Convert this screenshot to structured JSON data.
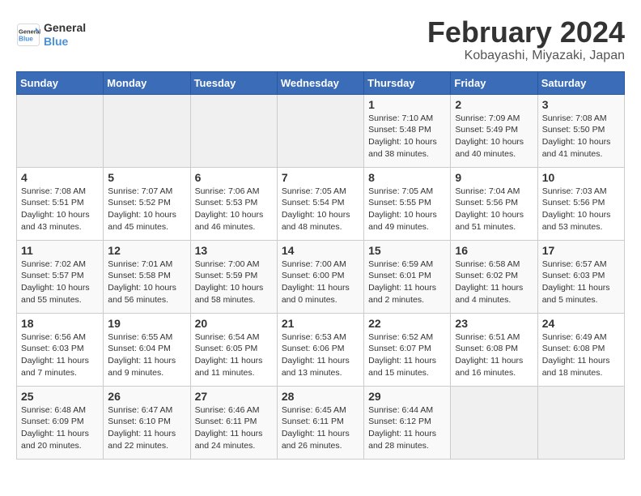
{
  "logo": {
    "line1": "General",
    "line2": "Blue"
  },
  "title": "February 2024",
  "subtitle": "Kobayashi, Miyazaki, Japan",
  "headers": [
    "Sunday",
    "Monday",
    "Tuesday",
    "Wednesday",
    "Thursday",
    "Friday",
    "Saturday"
  ],
  "weeks": [
    [
      {
        "day": "",
        "info": ""
      },
      {
        "day": "",
        "info": ""
      },
      {
        "day": "",
        "info": ""
      },
      {
        "day": "",
        "info": ""
      },
      {
        "day": "1",
        "info": "Sunrise: 7:10 AM\nSunset: 5:48 PM\nDaylight: 10 hours\nand 38 minutes."
      },
      {
        "day": "2",
        "info": "Sunrise: 7:09 AM\nSunset: 5:49 PM\nDaylight: 10 hours\nand 40 minutes."
      },
      {
        "day": "3",
        "info": "Sunrise: 7:08 AM\nSunset: 5:50 PM\nDaylight: 10 hours\nand 41 minutes."
      }
    ],
    [
      {
        "day": "4",
        "info": "Sunrise: 7:08 AM\nSunset: 5:51 PM\nDaylight: 10 hours\nand 43 minutes."
      },
      {
        "day": "5",
        "info": "Sunrise: 7:07 AM\nSunset: 5:52 PM\nDaylight: 10 hours\nand 45 minutes."
      },
      {
        "day": "6",
        "info": "Sunrise: 7:06 AM\nSunset: 5:53 PM\nDaylight: 10 hours\nand 46 minutes."
      },
      {
        "day": "7",
        "info": "Sunrise: 7:05 AM\nSunset: 5:54 PM\nDaylight: 10 hours\nand 48 minutes."
      },
      {
        "day": "8",
        "info": "Sunrise: 7:05 AM\nSunset: 5:55 PM\nDaylight: 10 hours\nand 49 minutes."
      },
      {
        "day": "9",
        "info": "Sunrise: 7:04 AM\nSunset: 5:56 PM\nDaylight: 10 hours\nand 51 minutes."
      },
      {
        "day": "10",
        "info": "Sunrise: 7:03 AM\nSunset: 5:56 PM\nDaylight: 10 hours\nand 53 minutes."
      }
    ],
    [
      {
        "day": "11",
        "info": "Sunrise: 7:02 AM\nSunset: 5:57 PM\nDaylight: 10 hours\nand 55 minutes."
      },
      {
        "day": "12",
        "info": "Sunrise: 7:01 AM\nSunset: 5:58 PM\nDaylight: 10 hours\nand 56 minutes."
      },
      {
        "day": "13",
        "info": "Sunrise: 7:00 AM\nSunset: 5:59 PM\nDaylight: 10 hours\nand 58 minutes."
      },
      {
        "day": "14",
        "info": "Sunrise: 7:00 AM\nSunset: 6:00 PM\nDaylight: 11 hours\nand 0 minutes."
      },
      {
        "day": "15",
        "info": "Sunrise: 6:59 AM\nSunset: 6:01 PM\nDaylight: 11 hours\nand 2 minutes."
      },
      {
        "day": "16",
        "info": "Sunrise: 6:58 AM\nSunset: 6:02 PM\nDaylight: 11 hours\nand 4 minutes."
      },
      {
        "day": "17",
        "info": "Sunrise: 6:57 AM\nSunset: 6:03 PM\nDaylight: 11 hours\nand 5 minutes."
      }
    ],
    [
      {
        "day": "18",
        "info": "Sunrise: 6:56 AM\nSunset: 6:03 PM\nDaylight: 11 hours\nand 7 minutes."
      },
      {
        "day": "19",
        "info": "Sunrise: 6:55 AM\nSunset: 6:04 PM\nDaylight: 11 hours\nand 9 minutes."
      },
      {
        "day": "20",
        "info": "Sunrise: 6:54 AM\nSunset: 6:05 PM\nDaylight: 11 hours\nand 11 minutes."
      },
      {
        "day": "21",
        "info": "Sunrise: 6:53 AM\nSunset: 6:06 PM\nDaylight: 11 hours\nand 13 minutes."
      },
      {
        "day": "22",
        "info": "Sunrise: 6:52 AM\nSunset: 6:07 PM\nDaylight: 11 hours\nand 15 minutes."
      },
      {
        "day": "23",
        "info": "Sunrise: 6:51 AM\nSunset: 6:08 PM\nDaylight: 11 hours\nand 16 minutes."
      },
      {
        "day": "24",
        "info": "Sunrise: 6:49 AM\nSunset: 6:08 PM\nDaylight: 11 hours\nand 18 minutes."
      }
    ],
    [
      {
        "day": "25",
        "info": "Sunrise: 6:48 AM\nSunset: 6:09 PM\nDaylight: 11 hours\nand 20 minutes."
      },
      {
        "day": "26",
        "info": "Sunrise: 6:47 AM\nSunset: 6:10 PM\nDaylight: 11 hours\nand 22 minutes."
      },
      {
        "day": "27",
        "info": "Sunrise: 6:46 AM\nSunset: 6:11 PM\nDaylight: 11 hours\nand 24 minutes."
      },
      {
        "day": "28",
        "info": "Sunrise: 6:45 AM\nSunset: 6:11 PM\nDaylight: 11 hours\nand 26 minutes."
      },
      {
        "day": "29",
        "info": "Sunrise: 6:44 AM\nSunset: 6:12 PM\nDaylight: 11 hours\nand 28 minutes."
      },
      {
        "day": "",
        "info": ""
      },
      {
        "day": "",
        "info": ""
      }
    ]
  ]
}
